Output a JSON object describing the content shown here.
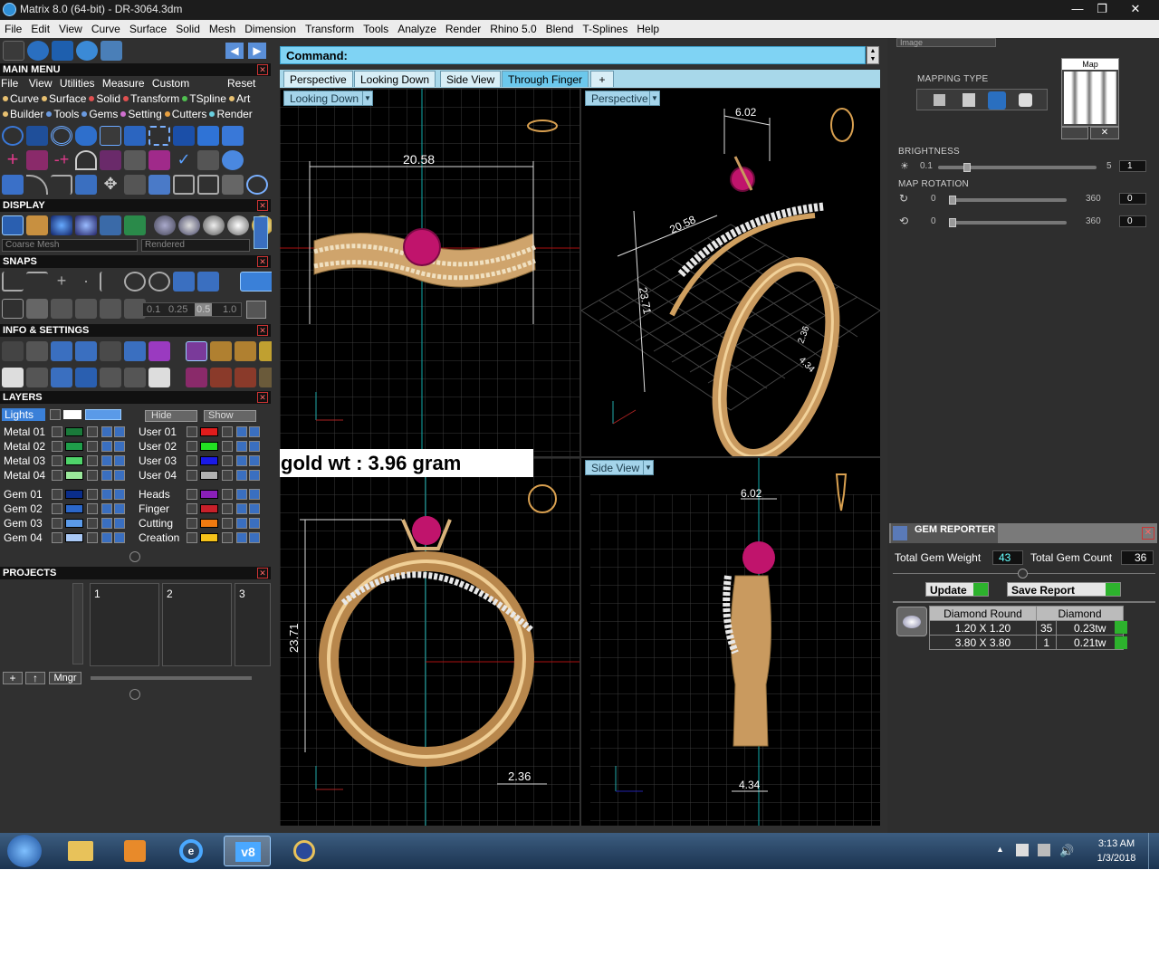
{
  "window": {
    "title": "Matrix 8.0 (64-bit) - DR-3064.3dm",
    "minimize": "—",
    "maximize": "❐",
    "close": "✕"
  },
  "menubar": [
    "File",
    "Edit",
    "View",
    "Curve",
    "Surface",
    "Solid",
    "Mesh",
    "Dimension",
    "Transform",
    "Tools",
    "Analyze",
    "Render",
    "Rhino 5.0",
    "Blend",
    "T-Splines",
    "Help"
  ],
  "left": {
    "main_menu": {
      "title": "MAIN MENU",
      "tabs": [
        "File",
        "View",
        "Utilities",
        "Measure",
        "Custom"
      ],
      "reset": "Reset",
      "categories1": [
        "Curve",
        "Surface",
        "Solid",
        "Transform",
        "TSpline",
        "Art"
      ],
      "categories2": [
        "Builder",
        "Tools",
        "Gems",
        "Setting",
        "Cutters",
        "Render"
      ]
    },
    "display": {
      "title": "DISPLAY",
      "mesh_select": "Coarse Mesh",
      "render_select": "Rendered"
    },
    "snaps": {
      "title": "SNAPS",
      "values": [
        "0.1",
        "0.25",
        "0.5",
        "1.0"
      ]
    },
    "info": {
      "title": "INFO & SETTINGS"
    },
    "layers": {
      "title": "LAYERS",
      "lights": "Lights",
      "hide": "Hide",
      "show": "Show",
      "left": [
        {
          "name": "Metal 01",
          "color": "#1a7a3a"
        },
        {
          "name": "Metal 02",
          "color": "#1f9e4a"
        },
        {
          "name": "Metal 03",
          "color": "#4fd46a"
        },
        {
          "name": "Metal 04",
          "color": "#9be89b"
        },
        {
          "name": "Gem 01",
          "color": "#0a2d8a"
        },
        {
          "name": "Gem 02",
          "color": "#2b67c9"
        },
        {
          "name": "Gem 03",
          "color": "#5b9ae8"
        },
        {
          "name": "Gem 04",
          "color": "#a9c8f5"
        }
      ],
      "right": [
        {
          "name": "User 01",
          "color": "#e11c1c"
        },
        {
          "name": "User 02",
          "color": "#22e022"
        },
        {
          "name": "User 03",
          "color": "#1a1ae6"
        },
        {
          "name": "User 04",
          "color": "#b0b0b0"
        },
        {
          "name": "Heads",
          "color": "#8a1fb8"
        },
        {
          "name": "Finger",
          "color": "#c8202a"
        },
        {
          "name": "Cutting",
          "color": "#f07a10"
        },
        {
          "name": "Creation",
          "color": "#f5c21a"
        }
      ]
    },
    "projects": {
      "title": "PROJECTS",
      "slots": [
        "1",
        "2",
        "3"
      ],
      "manager": "Mngr"
    }
  },
  "command": {
    "label": "Command:"
  },
  "tabs": [
    "Perspective",
    "Looking Down",
    "Side View",
    "Through Finger",
    "+"
  ],
  "active_tab": "Through Finger",
  "viewports": {
    "top": {
      "label": "Looking Down",
      "dim_width": "20.58"
    },
    "persp": {
      "label": "Perspective",
      "dim_top": "6.02",
      "dim_diag": "20.58",
      "dim_height": "23.71",
      "dim_small": "2.36",
      "dim_small2": "4.34"
    },
    "front": {
      "dim_height": "23.71",
      "dim_band": "2.36"
    },
    "side": {
      "label": "Side View",
      "dim_top": "6.02",
      "dim_bottom": "4.34"
    }
  },
  "annotation": "gold wt : 3.96 gram",
  "right": {
    "image_select": "Image",
    "mapping_type": "MAPPING TYPE",
    "map_label": "Map",
    "brightness": {
      "label": "BRIGHTNESS",
      "min": "0.1",
      "max": "5",
      "value": "1"
    },
    "map_rotation": {
      "label": "MAP ROTATION",
      "rows": [
        {
          "min": "0",
          "max": "360",
          "value": "0"
        },
        {
          "min": "0",
          "max": "360",
          "value": "0"
        }
      ]
    },
    "gem_reporter": {
      "title": "GEM REPORTER",
      "total_weight_label": "Total Gem Weight",
      "total_weight": "43",
      "total_count_label": "Total Gem Count",
      "total_count": "36",
      "update": "Update",
      "save": "Save Report",
      "headers": [
        "Diamond Round",
        "Diamond"
      ],
      "rows": [
        {
          "size": "1.20 X 1.20",
          "count": "35",
          "tw": "0.23tw"
        },
        {
          "size": "3.80 X 3.80",
          "count": "1",
          "tw": "0.21tw"
        }
      ]
    }
  },
  "taskbar": {
    "time": "3:13 AM",
    "date": "1/3/2018",
    "v8": "v8"
  },
  "colors": {
    "accent": "#7fd3f4",
    "gold": "#d9b27a",
    "gem": "#c0146c",
    "gold_dark": "#a07a44"
  }
}
